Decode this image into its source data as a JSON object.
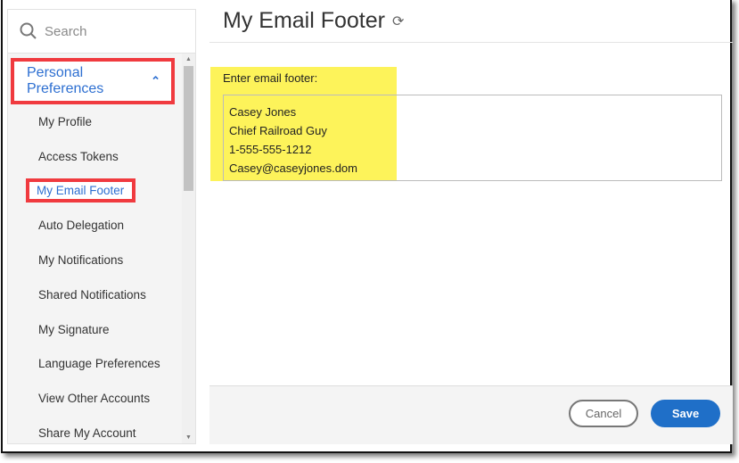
{
  "search": {
    "placeholder": "Search"
  },
  "sidebar": {
    "group": "Personal Preferences",
    "items": [
      "My Profile",
      "Access Tokens",
      "My Email Footer",
      "Auto Delegation",
      "My Notifications",
      "Shared Notifications",
      "My Signature",
      "Language Preferences",
      "View Other Accounts",
      "Share My Account"
    ]
  },
  "main": {
    "title": "My Email Footer",
    "label": "Enter email footer:",
    "footer_value": "Casey Jones\nChief Railroad Guy\n1-555-555-1212\nCasey@caseyjones.dom",
    "cancel": "Cancel",
    "save": "Save"
  }
}
